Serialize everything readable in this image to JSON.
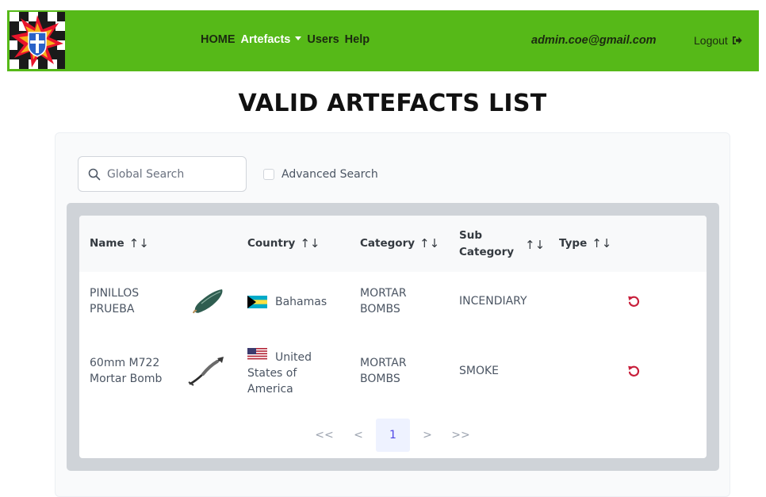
{
  "nav": {
    "home": "HOME",
    "artefacts": "Artefacts",
    "users": "Users",
    "help": "Help",
    "user_email": "admin.coe@gmail.com",
    "logout": "Logout",
    "logo_icon": "coat-of-arms-logo",
    "bar_color": "#56b918"
  },
  "page": {
    "title": "VALID ARTEFACTS LIST"
  },
  "search": {
    "placeholder": "Global Search",
    "advanced_label": "Advanced Search",
    "advanced_checked": false
  },
  "table": {
    "columns": {
      "name": "Name",
      "country": "Country",
      "category": "Category",
      "sub_category_line1": "Sub",
      "sub_category_line2": "Category",
      "type": "Type",
      "sort_glyph": "↑↓"
    },
    "rows": [
      {
        "name_line1": "PINILLOS",
        "name_line2": "PRUEBA",
        "image_icon": "artefact-thumbnail-green-shell",
        "country": "Bahamas",
        "flag_icon": "bahamas-flag-icon",
        "category_line1": "MORTAR",
        "category_line2": "BOMBS",
        "sub_category": "INCENDIARY",
        "type": "",
        "action_icon": "restore-icon"
      },
      {
        "name_line1": "60mm M722",
        "name_line2": "Mortar Bomb",
        "image_icon": "artefact-thumbnail-mortar",
        "country_line1": "United",
        "country_line2": "States of",
        "country_line3": "America",
        "flag_icon": "usa-flag-icon",
        "category_line1": "MORTAR",
        "category_line2": "BOMBS",
        "sub_category": "SMOKE",
        "type": "",
        "action_icon": "restore-icon"
      }
    ]
  },
  "pagination": {
    "first": "<<",
    "prev": "<",
    "current": "1",
    "next": ">",
    "last": ">>"
  },
  "colors": {
    "accent_red": "#c81e3a",
    "active_page_bg": "#eef2ff",
    "active_page_text": "#4f46e5"
  }
}
